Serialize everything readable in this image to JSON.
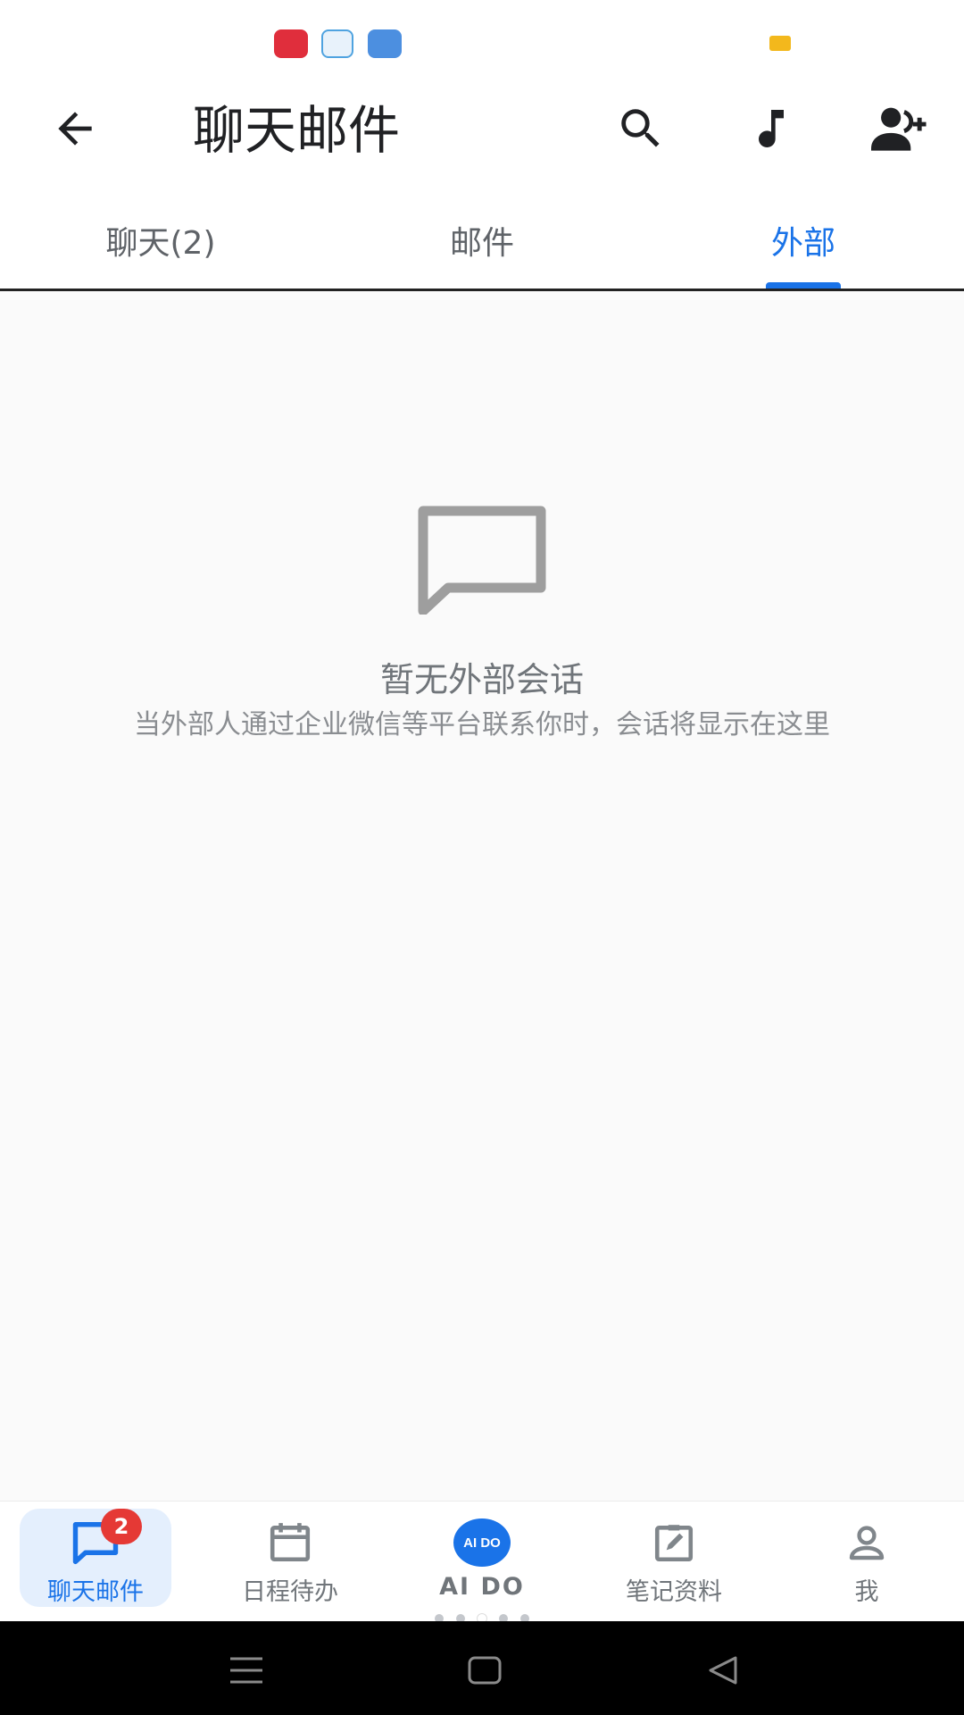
{
  "toolbar": {
    "title": "聊天邮件"
  },
  "tabs": [
    {
      "label": "聊天(2)"
    },
    {
      "label": "邮件"
    },
    {
      "label": "外部",
      "active": true
    }
  ],
  "empty_state": {
    "title": "暂无外部会话",
    "description": "当外部人通过企业微信等平台联系你时，会话将显示在这里"
  },
  "bottom_nav": [
    {
      "label": "聊天邮件",
      "badge": "2",
      "active": true
    },
    {
      "label": "日程待办"
    },
    {
      "label": "AI DO",
      "icon_text": "AI DO"
    },
    {
      "label": "笔记资料"
    },
    {
      "label": "我"
    }
  ],
  "colors": {
    "accent": "#1a73e8",
    "badge": "#e53935"
  }
}
